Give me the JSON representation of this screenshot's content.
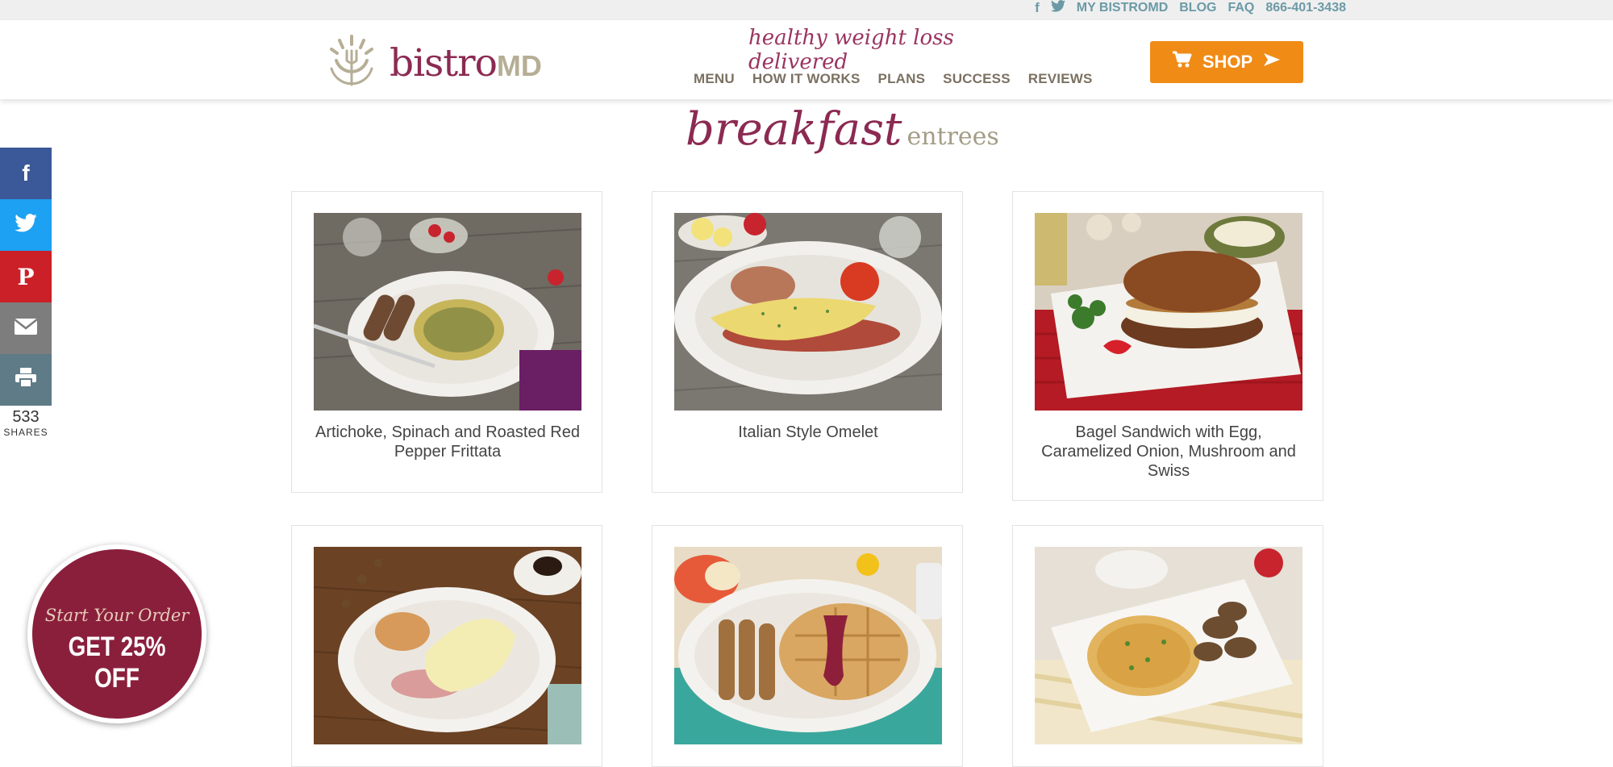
{
  "topbar": {
    "links": [
      "MY BISTROMD",
      "BLOG",
      "FAQ"
    ],
    "phone": "866-401-3438"
  },
  "header": {
    "logo_main": "bistro",
    "logo_suffix": "MD",
    "tagline": "healthy weight loss delivered",
    "nav": [
      "MENU",
      "HOW IT WORKS",
      "PLANS",
      "SUCCESS",
      "REVIEWS"
    ],
    "shop_label": "SHOP"
  },
  "page_title": {
    "main": "breakfast",
    "sub": "entrees"
  },
  "share": {
    "count": "533",
    "label": "SHARES"
  },
  "cards": [
    {
      "title": "Artichoke, Spinach and Roasted Red Pepper Frittata"
    },
    {
      "title": "Italian Style Omelet"
    },
    {
      "title": "Bagel Sandwich with Egg, Caramelized Onion, Mushroom and Swiss"
    },
    {
      "title": ""
    },
    {
      "title": ""
    },
    {
      "title": ""
    }
  ],
  "promo": {
    "line1": "Start Your Order",
    "line2": "GET 25% OFF"
  },
  "colors": {
    "brand": "#8b2a52",
    "accent_orange": "#f08b16",
    "facebook": "#3b5998",
    "twitter": "#1da1f2",
    "pinterest": "#cb2027",
    "email": "#7d7d7d",
    "print": "#5f7b87"
  }
}
